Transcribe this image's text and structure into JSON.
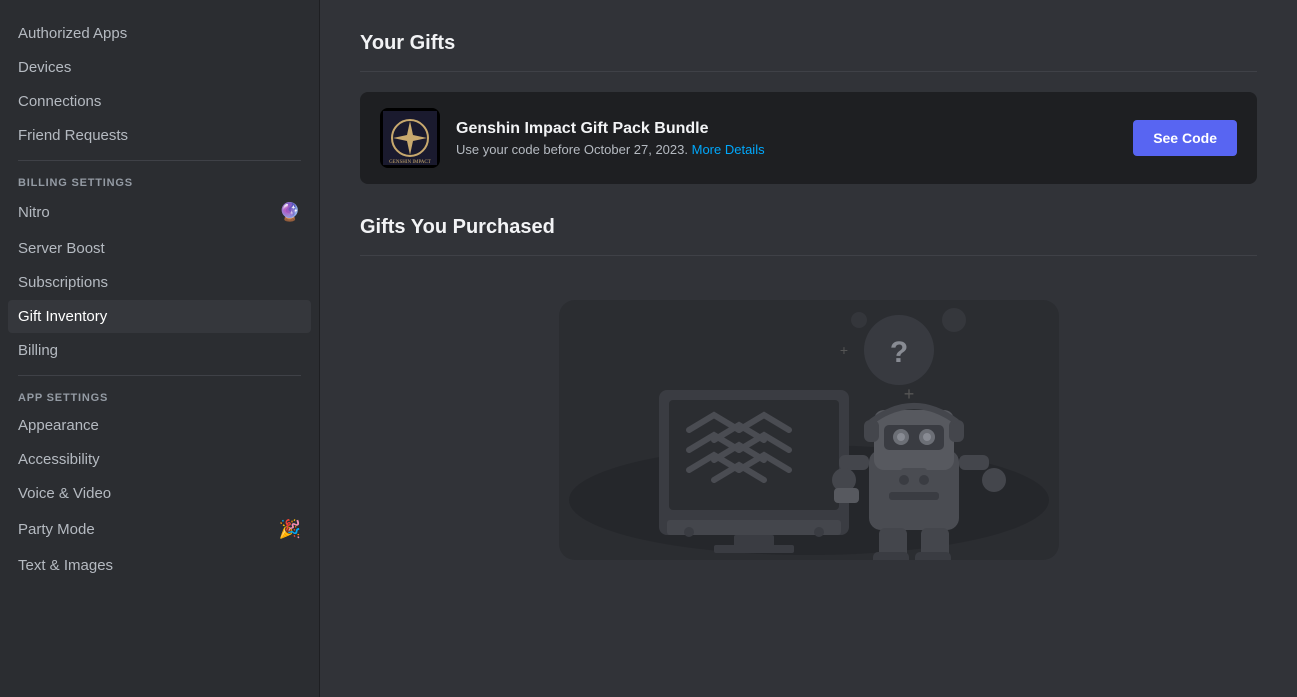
{
  "sidebar": {
    "items_top": [
      {
        "id": "authorized-apps",
        "label": "Authorized Apps",
        "active": false
      },
      {
        "id": "devices",
        "label": "Devices",
        "active": false
      },
      {
        "id": "connections",
        "label": "Connections",
        "active": false
      },
      {
        "id": "friend-requests",
        "label": "Friend Requests",
        "active": false
      }
    ],
    "billing_section_label": "BILLING SETTINGS",
    "billing_items": [
      {
        "id": "nitro",
        "label": "Nitro",
        "icon": "🔮",
        "active": false
      },
      {
        "id": "server-boost",
        "label": "Server Boost",
        "active": false
      },
      {
        "id": "subscriptions",
        "label": "Subscriptions",
        "active": false
      },
      {
        "id": "gift-inventory",
        "label": "Gift Inventory",
        "active": true
      },
      {
        "id": "billing",
        "label": "Billing",
        "active": false
      }
    ],
    "app_section_label": "APP SETTINGS",
    "app_items": [
      {
        "id": "appearance",
        "label": "Appearance",
        "active": false
      },
      {
        "id": "accessibility",
        "label": "Accessibility",
        "active": false
      },
      {
        "id": "voice-video",
        "label": "Voice & Video",
        "active": false
      },
      {
        "id": "party-mode",
        "label": "Party Mode",
        "icon": "🎉",
        "active": false
      },
      {
        "id": "text-images",
        "label": "Text & Images",
        "active": false
      }
    ]
  },
  "main": {
    "your_gifts_title": "Your Gifts",
    "gift_card": {
      "title": "Genshin Impact Gift Pack Bundle",
      "subtitle": "Use your code before October 27, 2023.",
      "subtitle_link": "More Details",
      "button_label": "See Code"
    },
    "purchased_title": "Gifts You Purchased"
  },
  "icons": {
    "nitro": "🔮",
    "party_mode": "🎉"
  }
}
